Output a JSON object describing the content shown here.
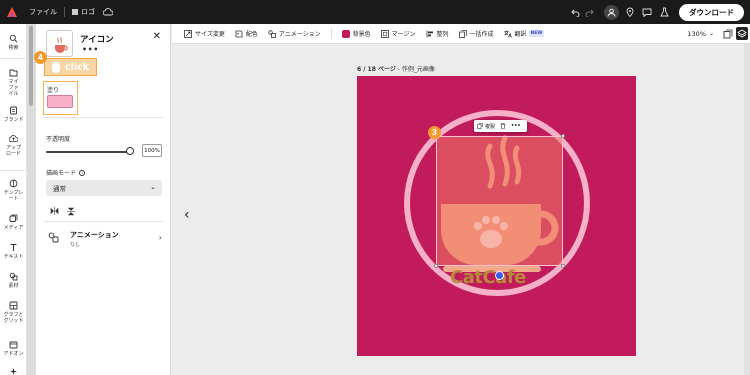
{
  "topbar": {
    "file_menu": "ファイル",
    "brand_logo": "ロゴ",
    "download_label": "ダウンロード",
    "colors": {
      "bg": "#1a1a1a"
    }
  },
  "rail": {
    "items": [
      {
        "label": "検索",
        "icon": "search-icon"
      },
      {
        "label": "マイファイル",
        "icon": "folder-icon"
      },
      {
        "label": "ブランド",
        "icon": "brand-icon"
      },
      {
        "label": "アップロード",
        "icon": "upload-icon"
      },
      {
        "label": "テンプレート",
        "icon": "template-icon"
      },
      {
        "label": "メディア",
        "icon": "media-icon"
      },
      {
        "label": "テキスト",
        "icon": "text-icon"
      },
      {
        "label": "素材",
        "icon": "elements-icon"
      },
      {
        "label": "グラフとグリッド",
        "icon": "chart-grid-icon"
      },
      {
        "label": "アドオン",
        "icon": "addon-icon"
      }
    ]
  },
  "panel": {
    "title": "アイコン",
    "more": "•••",
    "click_hint": "click",
    "step4": "4",
    "fill_label": "塗り",
    "fill_color": "#f6b1c8",
    "opacity_label": "不透明度",
    "opacity_value": "100%",
    "opacity_level": 1.0,
    "blend_label": "描画モード",
    "blend_value": "通常",
    "animation": {
      "title": "アニメーション",
      "subtitle": "なし"
    }
  },
  "toolbar": {
    "items": [
      {
        "label": "サイズ変更",
        "icon": "resize-icon"
      },
      {
        "label": "配色",
        "icon": "palette-icon"
      },
      {
        "label": "アニメーション",
        "icon": "animation-icon"
      },
      {
        "label": "背景色",
        "icon": "bg-color-swatch"
      },
      {
        "label": "マージン",
        "icon": "margin-icon"
      },
      {
        "label": "整列",
        "icon": "align-icon"
      },
      {
        "label": "一括作成",
        "icon": "bulk-create-icon"
      },
      {
        "label": "翻訳",
        "icon": "translate-icon"
      }
    ],
    "new_badge": "NEW",
    "zoom": "130%",
    "bg_color": "#c21b5b"
  },
  "canvas": {
    "page_current": "6 / 18 ページ",
    "page_name": " - 作例_元画像",
    "artboard_color": "#c21b5b",
    "step3": "3",
    "float_toolbar": {
      "duplicate": "複製"
    },
    "logo_text": "CatCafe"
  }
}
